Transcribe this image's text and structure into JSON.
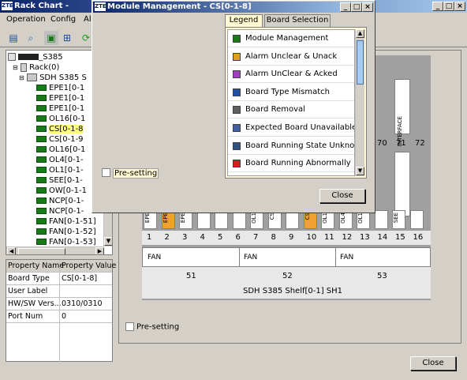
{
  "main_window": {
    "logo": "ZTE",
    "title": "Rack Chart - ",
    "controls": {
      "minimize": "_",
      "maximize": "□",
      "close": "×"
    }
  },
  "menu": [
    "Operation",
    "Config",
    "Al"
  ],
  "tree": {
    "root": "_S385",
    "rack": "Rack(0)",
    "shelf": "SDH S385 S",
    "items": [
      "EPE1[0-1",
      "EPE1[0-1",
      "EPE1[0-1",
      "OL16[0-1",
      "CS[0-1-8",
      "CS[0-1-9",
      "OL16[0-1",
      "OL4[0-1-",
      "OL1[0-1-",
      "SEE[0-1-",
      "OW[0-1-1",
      "NCP[0-1-",
      "NCP[0-1-",
      "FAN[0-1-51]",
      "FAN[0-1-52]",
      "FAN[0-1-53]"
    ]
  },
  "properties": {
    "headers": [
      "Property Name",
      "Property Value"
    ],
    "rows": [
      [
        "Board Type",
        "CS[0-1-8]"
      ],
      [
        "User Label",
        ""
      ],
      [
        "HW/SW Vers...",
        "0310/0310"
      ],
      [
        "Port Num",
        "0"
      ]
    ]
  },
  "shelf": {
    "slot_numbers": [
      "1",
      "2",
      "3",
      "4",
      "5",
      "6",
      "7",
      "8",
      "9",
      "10",
      "11",
      "12",
      "13",
      "14",
      "15",
      "16"
    ],
    "upper_numbers": [
      "70",
      "71",
      "72"
    ],
    "interface_label": "INTERFACE",
    "slot_labels": [
      "EPE",
      "EPE",
      "EPE",
      "",
      "",
      "",
      "OL1",
      "CS",
      "",
      "CS",
      "OL1",
      "OL4",
      "OL1",
      "",
      "SEE",
      ""
    ],
    "fan_labels": [
      "FAN",
      "FAN",
      "FAN"
    ],
    "fan_numbers": [
      "51",
      "52",
      "53"
    ],
    "name": "SDH S385 Shelf[0-1] SH1"
  },
  "main_presetting": "Pre-setting",
  "main_close": "Close",
  "dialog": {
    "logo": "ZTE",
    "title": "Module Management - CS[0-1-8]",
    "tabs": [
      "Legend",
      "Board Selection"
    ],
    "legend_items": [
      {
        "label": "Module Management",
        "icon": "module-icon",
        "color": "#1a7a1a"
      },
      {
        "label": "Alarm Unclear & Unack",
        "icon": "alarm-unack-icon",
        "color": "#e0a020"
      },
      {
        "label": "Alarm UnClear & Acked",
        "icon": "alarm-acked-icon",
        "color": "#a040c0"
      },
      {
        "label": "Board Type Mismatch",
        "icon": "mismatch-icon",
        "color": "#2050a0"
      },
      {
        "label": "Board Removal",
        "icon": "removal-icon",
        "color": "#606060"
      },
      {
        "label": "Expected Board Unavailable",
        "icon": "unavailable-icon",
        "color": "#4060a0"
      },
      {
        "label": "Board Running State Unkno...",
        "icon": "unknown-state-icon",
        "color": "#305080"
      },
      {
        "label": "Board Running Abnormally",
        "icon": "abnormal-icon",
        "color": "#d02020"
      }
    ],
    "presetting": "Pre-setting",
    "close": "Close"
  }
}
